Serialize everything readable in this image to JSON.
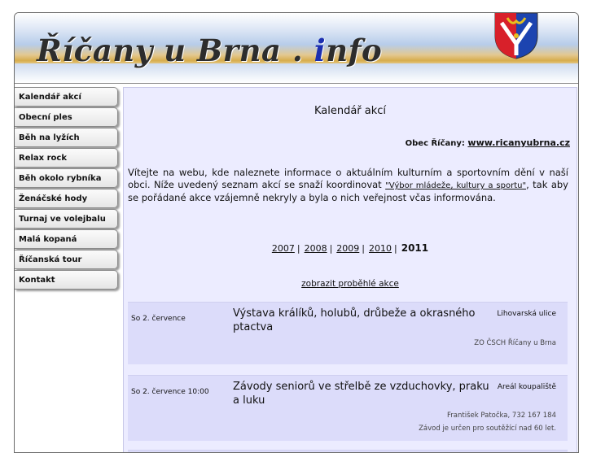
{
  "header": {
    "title_main": "Říčany u Brna . ",
    "title_i": "i",
    "title_end": "nfo",
    "colors": {
      "crest_red": "#d8202a",
      "crest_blue": "#1c44b0",
      "crest_gold": "#e6c020"
    }
  },
  "sidebar": {
    "items": [
      {
        "label": "Kalendář akcí"
      },
      {
        "label": "Obecní ples"
      },
      {
        "label": "Běh na lyžích"
      },
      {
        "label": "Relax rock"
      },
      {
        "label": "Běh okolo rybníka"
      },
      {
        "label": "Ženáčské hody"
      },
      {
        "label": "Turnaj ve volejbalu"
      },
      {
        "label": "Malá kopaná"
      },
      {
        "label": "Říčanská tour"
      },
      {
        "label": "Kontakt"
      }
    ]
  },
  "main": {
    "title": "Kalendář akcí",
    "obec_label": "Obec Říčany:",
    "obec_link": "www.ricanyubrna.cz",
    "intro_part1": "Vítejte na webu, kde naleznete informace o aktuálním kulturním a sportovním dění v naší obci. Níže uvedený seznam akcí se snaží koordinovat ",
    "intro_link": "\"Výbor mládeže, kultury a sportu\"",
    "intro_part2": ", tak aby se pořádané akce vzájemně nekryly a byla o nich veřejnost včas informována.",
    "years": [
      "2007",
      "2008",
      "2009",
      "2010"
    ],
    "year_separator": "|",
    "current_year": "2011",
    "show_past": "zobrazit proběhlé akce",
    "events": [
      {
        "date": "So 2. července",
        "title": "Výstava králíků, holubů, drůbeže a okrasného ptactva",
        "place": "Lihovarská ulice",
        "organizer": "ZO ČSCH Říčany u Brna",
        "note": ""
      },
      {
        "date": "So 2. července 10:00",
        "title": "Závody seniorů ve střelbě ze vzduchovky, praku a luku",
        "place": "Areál koupaliště",
        "organizer": "František Patočka, 732 167 184",
        "note": "Závod je určen pro soutěžící nad 60 let."
      }
    ]
  }
}
